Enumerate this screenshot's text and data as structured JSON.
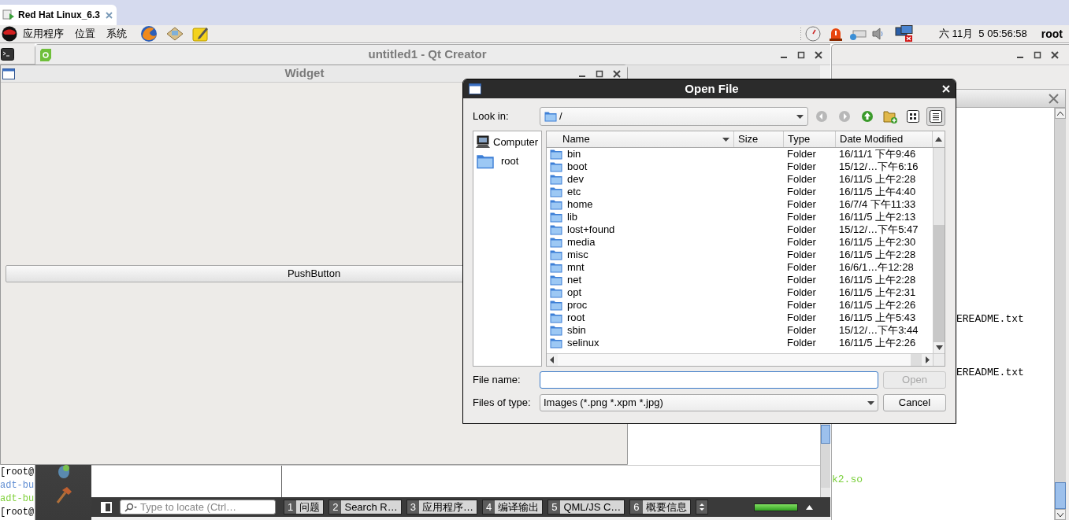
{
  "browser_tab": {
    "title": "Red Hat Linux_6.3"
  },
  "panel": {
    "menus": [
      "应用程序",
      "位置",
      "系统"
    ],
    "clock": "六 11月  5 05:56:58",
    "user": "root"
  },
  "terminal_lines": [
    {
      "text": "[root@",
      "color": "#000000"
    },
    {
      "text": "adt-bu",
      "color": "#5f8dd3"
    },
    {
      "text": "adt-bu",
      "color": "#7fd03a"
    },
    {
      "text": "[root@",
      "color": "#000000"
    }
  ],
  "qt_creator": {
    "title": "untitled1 - Qt Creator",
    "locator": {
      "placeholder": "Type to locate (Ctrl…"
    },
    "output_tabs": [
      {
        "number": "1",
        "label": "问题"
      },
      {
        "number": "2",
        "label": "Search R…"
      },
      {
        "number": "3",
        "label": "应用程序…"
      },
      {
        "number": "4",
        "label": "编译输出"
      },
      {
        "number": "5",
        "label": "QML/JS C…"
      },
      {
        "number": "6",
        "label": "概要信息"
      }
    ],
    "progress": {
      "level": 1
    }
  },
  "side_window": {
    "lines": [
      {
        "text": "EREADME.txt",
        "kind": "plain"
      },
      {
        "text": "EREADME.txt",
        "kind": "plain"
      },
      {
        "text": "k2.so",
        "kind": "library"
      }
    ]
  },
  "widget": {
    "title": "Widget",
    "button": "PushButton"
  },
  "dialog": {
    "title": "Open File",
    "look_in": {
      "label": "Look in:",
      "value": "/"
    },
    "places": [
      {
        "label": "Computer",
        "kind": "computer"
      },
      {
        "label": "root",
        "kind": "folder"
      }
    ],
    "columns": [
      "Name",
      "Size",
      "Type",
      "Date Modified"
    ],
    "rows": [
      {
        "name": "bin",
        "type": "Folder",
        "modified": "16/11/1 下午9:46"
      },
      {
        "name": "boot",
        "type": "Folder",
        "modified": "15/12/…下午6:16"
      },
      {
        "name": "dev",
        "type": "Folder",
        "modified": "16/11/5 上午2:28"
      },
      {
        "name": "etc",
        "type": "Folder",
        "modified": "16/11/5 上午4:40"
      },
      {
        "name": "home",
        "type": "Folder",
        "modified": "16/7/4 下午11:33"
      },
      {
        "name": "lib",
        "type": "Folder",
        "modified": "16/11/5 上午2:13"
      },
      {
        "name": "lost+found",
        "type": "Folder",
        "modified": "15/12/…下午5:47"
      },
      {
        "name": "media",
        "type": "Folder",
        "modified": "16/11/5 上午2:30"
      },
      {
        "name": "misc",
        "type": "Folder",
        "modified": "16/11/5 上午2:28"
      },
      {
        "name": "mnt",
        "type": "Folder",
        "modified": "16/6/1…午12:28"
      },
      {
        "name": "net",
        "type": "Folder",
        "modified": "16/11/5 上午2:28"
      },
      {
        "name": "opt",
        "type": "Folder",
        "modified": "16/11/5 上午2:31"
      },
      {
        "name": "proc",
        "type": "Folder",
        "modified": "16/11/5 上午2:26"
      },
      {
        "name": "root",
        "type": "Folder",
        "modified": "16/11/5 上午5:43"
      },
      {
        "name": "sbin",
        "type": "Folder",
        "modified": "15/12/…下午3:44"
      },
      {
        "name": "selinux",
        "type": "Folder",
        "modified": "16/11/5 上午2:26"
      }
    ],
    "file_name": {
      "label": "File name:"
    },
    "open_button": {
      "label": "Open",
      "disabled": true
    },
    "file_type": {
      "label": "Files of type:",
      "value": "Images (*.png *.xpm *.jpg)"
    },
    "cancel_button": "Cancel"
  }
}
